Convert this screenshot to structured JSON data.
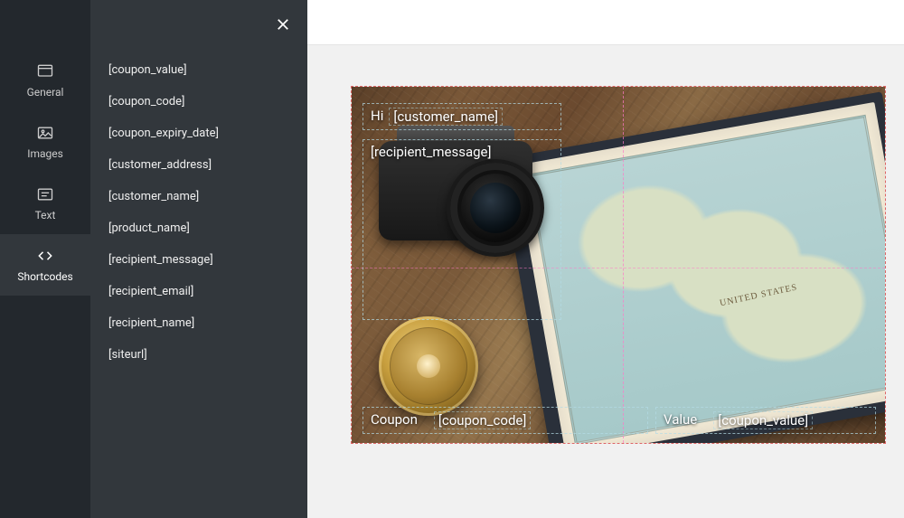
{
  "sidebar": {
    "tabs": [
      {
        "id": "general",
        "label": "General"
      },
      {
        "id": "images",
        "label": "Images"
      },
      {
        "id": "text",
        "label": "Text"
      },
      {
        "id": "shortcodes",
        "label": "Shortcodes"
      }
    ],
    "active_tab": "shortcodes"
  },
  "shortcodes": [
    "[coupon_value]",
    "[coupon_code]",
    "[coupon_expiry_date]",
    "[customer_address]",
    "[customer_name]",
    "[product_name]",
    "[recipient_message]",
    "[recipient_email]",
    "[recipient_name]",
    "[siteurl]"
  ],
  "template": {
    "greeting_prefix": "Hi",
    "greeting_shortcode": "[customer_name]",
    "message_shortcode": "[recipient_message]",
    "coupon_label": "Coupon",
    "coupon_shortcode": "[coupon_code]",
    "value_label": "Value",
    "value_shortcode": "[coupon_value]",
    "map_country": "UNITED STATES"
  }
}
